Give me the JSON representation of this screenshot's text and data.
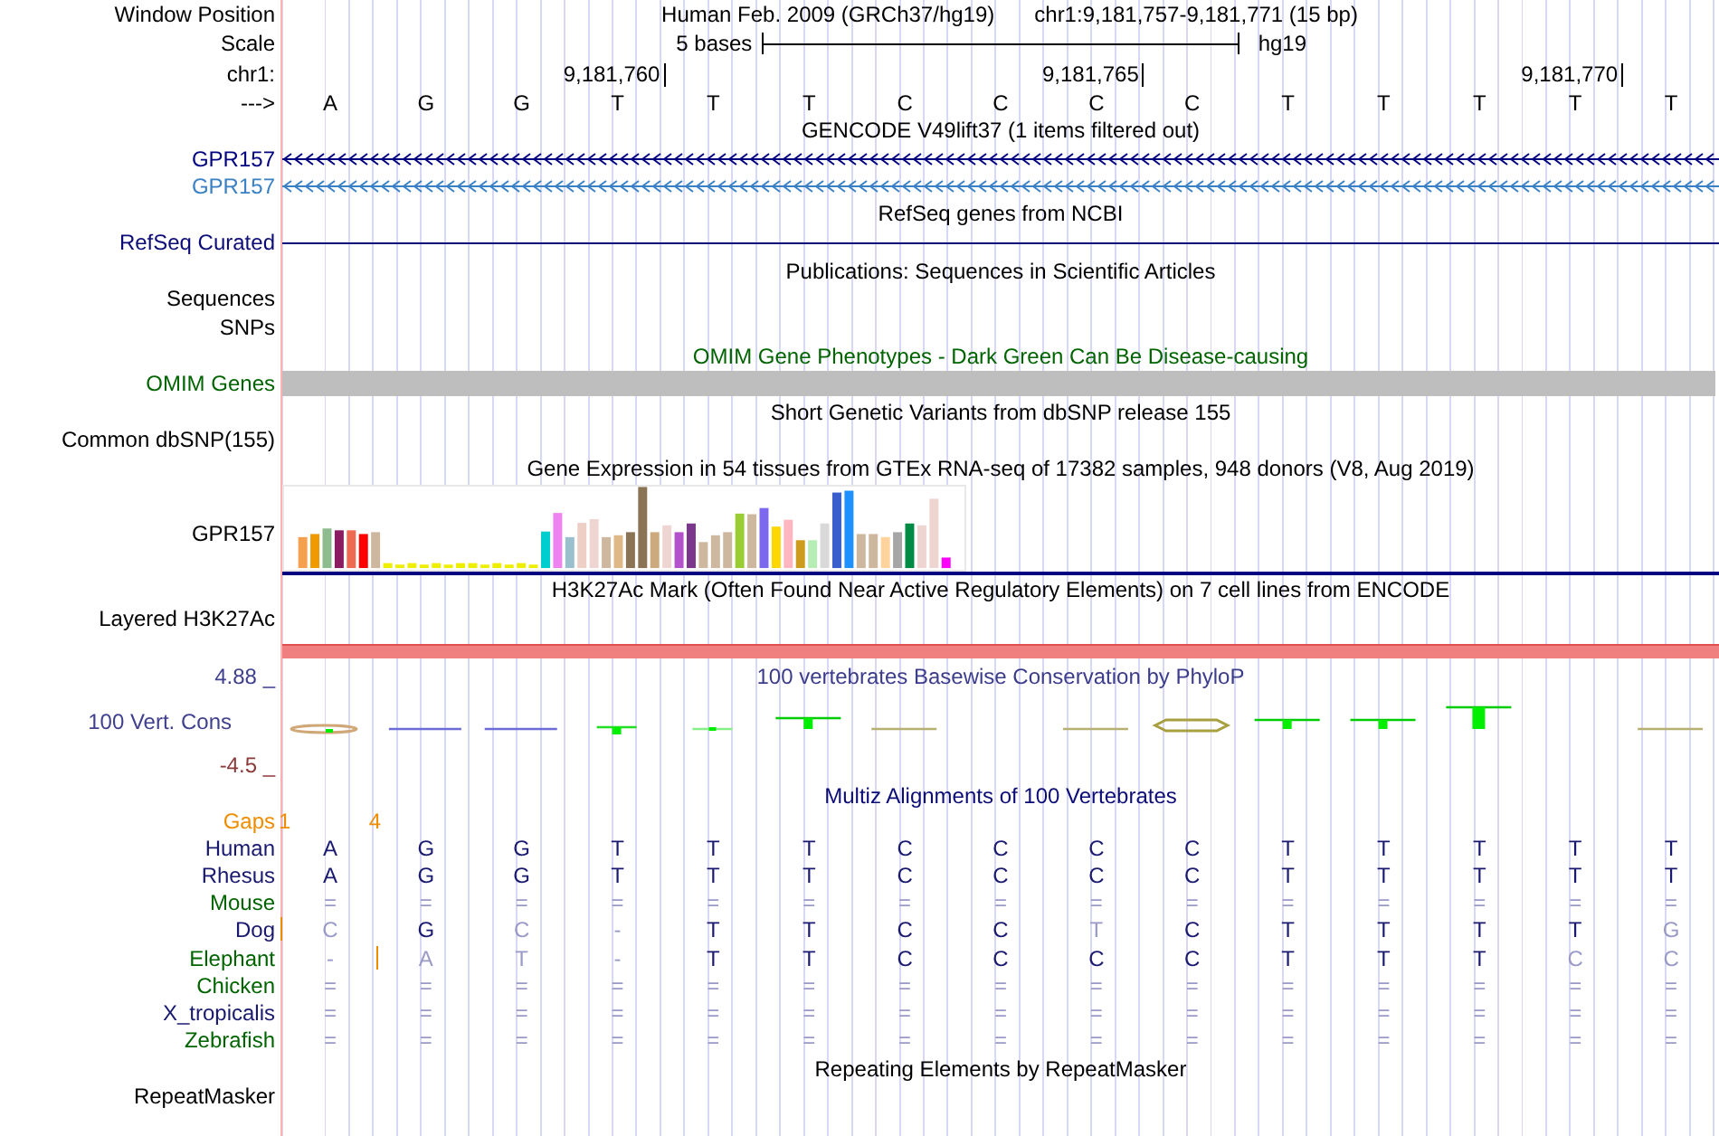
{
  "header": {
    "label": "Window Position",
    "assembly": "Human Feb. 2009 (GRCh37/hg19)",
    "range": "chr1:9,181,757-9,181,771 (15 bp)"
  },
  "scale": {
    "label": "Scale",
    "bar_label": "5 bases",
    "db": "hg19"
  },
  "ruler": {
    "label": "chr1:",
    "ticks": [
      "9,181,760",
      "9,181,765",
      "9,181,770"
    ]
  },
  "sequence": {
    "label": "--->",
    "bases": [
      "A",
      "G",
      "G",
      "T",
      "T",
      "T",
      "C",
      "C",
      "C",
      "C",
      "T",
      "T",
      "T",
      "T",
      "T"
    ]
  },
  "tracks": [
    {
      "kind": "genes",
      "title": "GENCODE V49lift37 (1 items filtered out)",
      "rows": [
        {
          "label": "GPR157",
          "color": "#000080"
        },
        {
          "label": "GPR157",
          "color": "#3a80c4"
        }
      ]
    },
    {
      "kind": "line",
      "title": "RefSeq genes from NCBI",
      "label": "RefSeq Curated"
    },
    {
      "kind": "empty",
      "title": "Publications: Sequences in Scientific Articles",
      "labels": [
        "Sequences",
        "SNPs"
      ]
    },
    {
      "kind": "bar",
      "title": "OMIM Gene Phenotypes - Dark Green Can Be Disease-causing",
      "label": "OMIM Genes"
    },
    {
      "kind": "empty",
      "title": "Short Genetic Variants from dbSNP release 155",
      "labels": [
        "Common dbSNP(155)"
      ]
    },
    {
      "kind": "expression",
      "title": "Gene Expression in 54 tissues from GTEx RNA-seq of 17382 samples, 948 donors (V8, Aug 2019)",
      "label": "GPR157"
    },
    {
      "kind": "signal",
      "title": "H3K27Ac Mark (Often Found Near Active Regulatory Elements) on 7 cell lines from ENCODE",
      "label": "Layered H3K27Ac"
    },
    {
      "kind": "conservation",
      "title": "100 vertebrates Basewise Conservation by PhyloP",
      "label": "100 Vert. Cons",
      "max": "4.88 _",
      "min": "-4.5 _"
    },
    {
      "kind": "alignment",
      "title": "Multiz Alignments of 100 Vertebrates",
      "gaps": {
        "label": "Gaps",
        "marks": [
          "1",
          "4"
        ]
      },
      "species": [
        {
          "name": "Human",
          "color": "#191970",
          "bases": [
            {
              "b": "A",
              "match": true,
              "insert": false
            },
            {
              "b": "G",
              "match": true,
              "insert": false
            },
            {
              "b": "G",
              "match": true,
              "insert": false
            },
            {
              "b": "T",
              "match": true,
              "insert": false
            },
            {
              "b": "T",
              "match": true,
              "insert": false
            },
            {
              "b": "T",
              "match": true,
              "insert": false
            },
            {
              "b": "C",
              "match": true,
              "insert": false
            },
            {
              "b": "C",
              "match": true,
              "insert": false
            },
            {
              "b": "C",
              "match": true,
              "insert": false
            },
            {
              "b": "C",
              "match": true,
              "insert": false
            },
            {
              "b": "T",
              "match": true,
              "insert": false
            },
            {
              "b": "T",
              "match": true,
              "insert": false
            },
            {
              "b": "T",
              "match": true,
              "insert": false
            },
            {
              "b": "T",
              "match": true,
              "insert": false
            },
            {
              "b": "T",
              "match": true,
              "insert": false
            }
          ]
        },
        {
          "name": "Rhesus",
          "color": "#191970",
          "bases": [
            {
              "b": "A",
              "match": true,
              "insert": false
            },
            {
              "b": "G",
              "match": true,
              "insert": false
            },
            {
              "b": "G",
              "match": true,
              "insert": false
            },
            {
              "b": "T",
              "match": true,
              "insert": false
            },
            {
              "b": "T",
              "match": true,
              "insert": false
            },
            {
              "b": "T",
              "match": true,
              "insert": false
            },
            {
              "b": "C",
              "match": true,
              "insert": false
            },
            {
              "b": "C",
              "match": true,
              "insert": false
            },
            {
              "b": "C",
              "match": true,
              "insert": false
            },
            {
              "b": "C",
              "match": true,
              "insert": false
            },
            {
              "b": "T",
              "match": true,
              "insert": false
            },
            {
              "b": "T",
              "match": true,
              "insert": false
            },
            {
              "b": "T",
              "match": true,
              "insert": false
            },
            {
              "b": "T",
              "match": true,
              "insert": false
            },
            {
              "b": "T",
              "match": true,
              "insert": false
            }
          ]
        },
        {
          "name": "Mouse",
          "color": "#006400",
          "bases": [
            {
              "b": "=",
              "match": false,
              "insert": false
            },
            {
              "b": "=",
              "match": false,
              "insert": false
            },
            {
              "b": "=",
              "match": false,
              "insert": false
            },
            {
              "b": "=",
              "match": false,
              "insert": false
            },
            {
              "b": "=",
              "match": false,
              "insert": false
            },
            {
              "b": "=",
              "match": false,
              "insert": false
            },
            {
              "b": "=",
              "match": false,
              "insert": false
            },
            {
              "b": "=",
              "match": false,
              "insert": false
            },
            {
              "b": "=",
              "match": false,
              "insert": false
            },
            {
              "b": "=",
              "match": false,
              "insert": false
            },
            {
              "b": "=",
              "match": false,
              "insert": false
            },
            {
              "b": "=",
              "match": false,
              "insert": false
            },
            {
              "b": "=",
              "match": false,
              "insert": false
            },
            {
              "b": "=",
              "match": false,
              "insert": false
            },
            {
              "b": "=",
              "match": false,
              "insert": false
            }
          ]
        },
        {
          "name": "Dog",
          "color": "#191970",
          "bases": [
            {
              "b": "C",
              "match": false,
              "insert": true
            },
            {
              "b": "G",
              "match": true,
              "insert": false
            },
            {
              "b": "C",
              "match": false,
              "insert": false
            },
            {
              "b": "-",
              "match": false,
              "insert": false
            },
            {
              "b": "T",
              "match": true,
              "insert": false
            },
            {
              "b": "T",
              "match": true,
              "insert": false
            },
            {
              "b": "C",
              "match": true,
              "insert": false
            },
            {
              "b": "C",
              "match": true,
              "insert": false
            },
            {
              "b": "T",
              "match": false,
              "insert": false
            },
            {
              "b": "C",
              "match": true,
              "insert": false
            },
            {
              "b": "T",
              "match": true,
              "insert": false
            },
            {
              "b": "T",
              "match": true,
              "insert": false
            },
            {
              "b": "T",
              "match": true,
              "insert": false
            },
            {
              "b": "T",
              "match": true,
              "insert": false
            },
            {
              "b": "G",
              "match": false,
              "insert": false
            }
          ]
        },
        {
          "name": "Elephant",
          "color": "#006400",
          "bases": [
            {
              "b": "-",
              "match": false,
              "insert": false
            },
            {
              "b": "A",
              "match": false,
              "insert": true
            },
            {
              "b": "T",
              "match": false,
              "insert": false
            },
            {
              "b": "-",
              "match": false,
              "insert": false
            },
            {
              "b": "T",
              "match": true,
              "insert": false
            },
            {
              "b": "T",
              "match": true,
              "insert": false
            },
            {
              "b": "C",
              "match": true,
              "insert": false
            },
            {
              "b": "C",
              "match": true,
              "insert": false
            },
            {
              "b": "C",
              "match": true,
              "insert": false
            },
            {
              "b": "C",
              "match": true,
              "insert": false
            },
            {
              "b": "T",
              "match": true,
              "insert": false
            },
            {
              "b": "T",
              "match": true,
              "insert": false
            },
            {
              "b": "T",
              "match": true,
              "insert": false
            },
            {
              "b": "C",
              "match": false,
              "insert": false
            },
            {
              "b": "C",
              "match": false,
              "insert": false
            }
          ]
        },
        {
          "name": "Chicken",
          "color": "#006400",
          "bases": [
            {
              "b": "=",
              "match": false,
              "insert": false
            },
            {
              "b": "=",
              "match": false,
              "insert": false
            },
            {
              "b": "=",
              "match": false,
              "insert": false
            },
            {
              "b": "=",
              "match": false,
              "insert": false
            },
            {
              "b": "=",
              "match": false,
              "insert": false
            },
            {
              "b": "=",
              "match": false,
              "insert": false
            },
            {
              "b": "=",
              "match": false,
              "insert": false
            },
            {
              "b": "=",
              "match": false,
              "insert": false
            },
            {
              "b": "=",
              "match": false,
              "insert": false
            },
            {
              "b": "=",
              "match": false,
              "insert": false
            },
            {
              "b": "=",
              "match": false,
              "insert": false
            },
            {
              "b": "=",
              "match": false,
              "insert": false
            },
            {
              "b": "=",
              "match": false,
              "insert": false
            },
            {
              "b": "=",
              "match": false,
              "insert": false
            },
            {
              "b": "=",
              "match": false,
              "insert": false
            }
          ]
        },
        {
          "name": "X_tropicalis",
          "color": "#191970",
          "bases": [
            {
              "b": "=",
              "match": false,
              "insert": false
            },
            {
              "b": "=",
              "match": false,
              "insert": false
            },
            {
              "b": "=",
              "match": false,
              "insert": false
            },
            {
              "b": "=",
              "match": false,
              "insert": false
            },
            {
              "b": "=",
              "match": false,
              "insert": false
            },
            {
              "b": "=",
              "match": false,
              "insert": false
            },
            {
              "b": "=",
              "match": false,
              "insert": false
            },
            {
              "b": "=",
              "match": false,
              "insert": false
            },
            {
              "b": "=",
              "match": false,
              "insert": false
            },
            {
              "b": "=",
              "match": false,
              "insert": false
            },
            {
              "b": "=",
              "match": false,
              "insert": false
            },
            {
              "b": "=",
              "match": false,
              "insert": false
            },
            {
              "b": "=",
              "match": false,
              "insert": false
            },
            {
              "b": "=",
              "match": false,
              "insert": false
            },
            {
              "b": "=",
              "match": false,
              "insert": false
            }
          ]
        },
        {
          "name": "Zebrafish",
          "color": "#006400",
          "bases": [
            {
              "b": "=",
              "match": false,
              "insert": false
            },
            {
              "b": "=",
              "match": false,
              "insert": false
            },
            {
              "b": "=",
              "match": false,
              "insert": false
            },
            {
              "b": "=",
              "match": false,
              "insert": false
            },
            {
              "b": "=",
              "match": false,
              "insert": false
            },
            {
              "b": "=",
              "match": false,
              "insert": false
            },
            {
              "b": "=",
              "match": false,
              "insert": false
            },
            {
              "b": "=",
              "match": false,
              "insert": false
            },
            {
              "b": "=",
              "match": false,
              "insert": false
            },
            {
              "b": "=",
              "match": false,
              "insert": false
            },
            {
              "b": "=",
              "match": false,
              "insert": false
            },
            {
              "b": "=",
              "match": false,
              "insert": false
            },
            {
              "b": "=",
              "match": false,
              "insert": false
            },
            {
              "b": "=",
              "match": false,
              "insert": false
            },
            {
              "b": "=",
              "match": false,
              "insert": false
            }
          ]
        }
      ]
    },
    {
      "kind": "empty",
      "title": "Repeating Elements by RepeatMasker",
      "labels": [
        "RepeatMasker"
      ]
    }
  ]
}
